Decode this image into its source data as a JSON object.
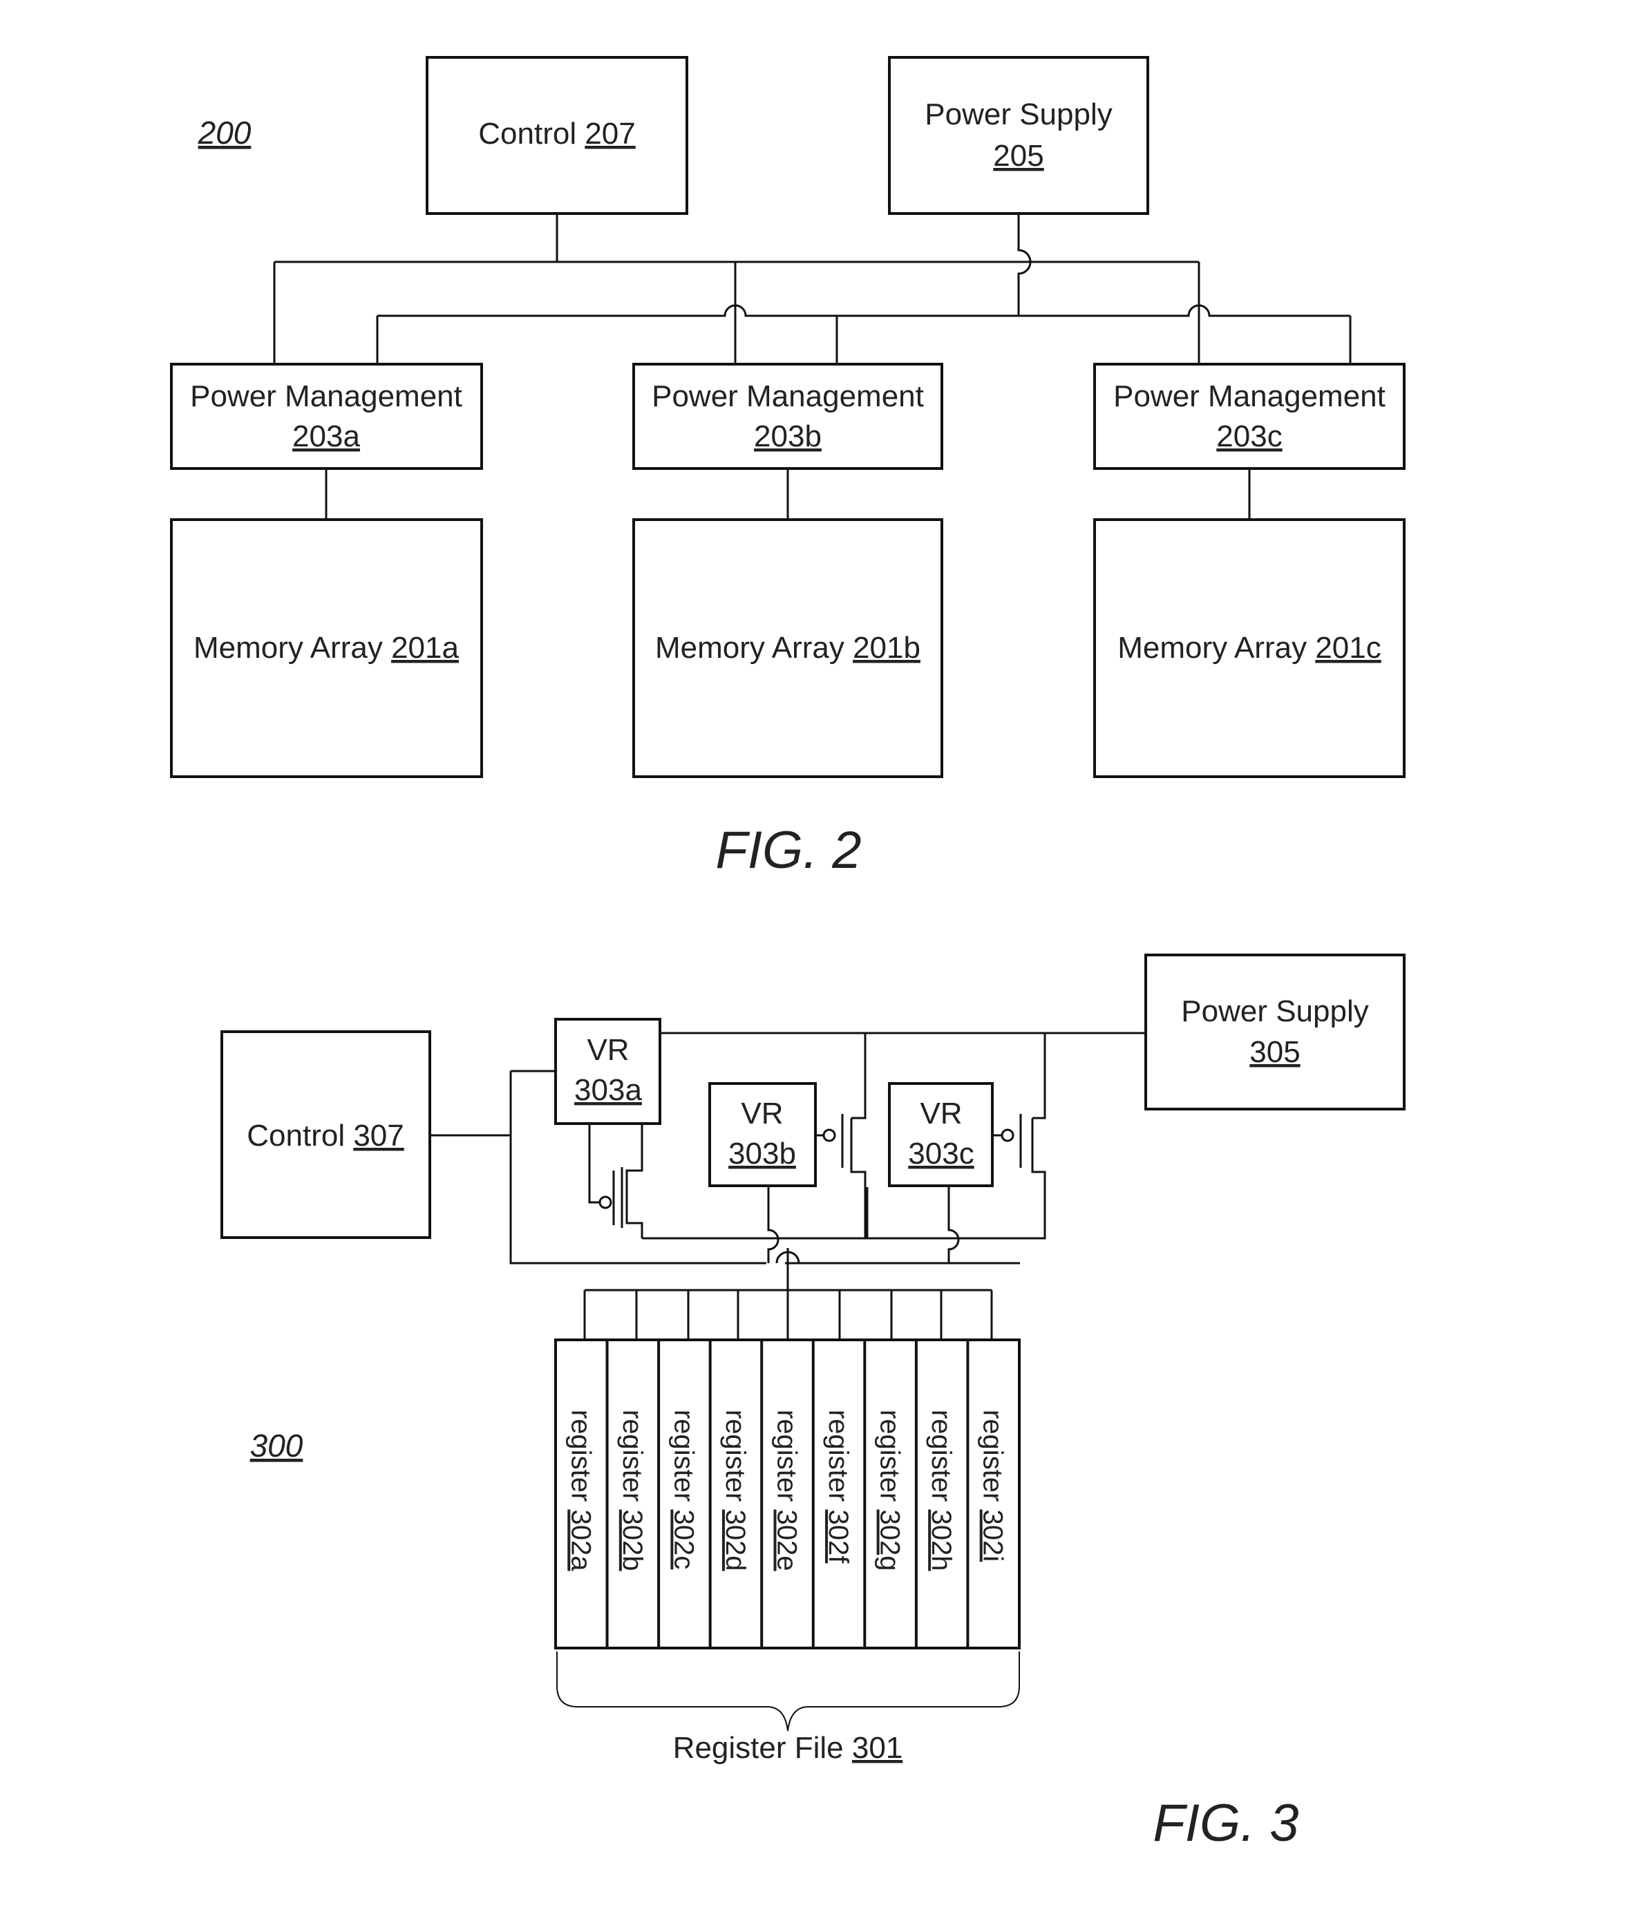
{
  "fig2": {
    "figure_number": "200",
    "caption": "FIG. 2",
    "control": {
      "label": "Control",
      "ref": "207"
    },
    "power_supply": {
      "label": "Power Supply",
      "ref": "205"
    },
    "power_management": [
      {
        "label": "Power Management",
        "ref": "203a"
      },
      {
        "label": "Power Management",
        "ref": "203b"
      },
      {
        "label": "Power Management",
        "ref": "203c"
      }
    ],
    "memory_arrays": [
      {
        "label": "Memory Array",
        "ref": "201a"
      },
      {
        "label": "Memory Array",
        "ref": "201b"
      },
      {
        "label": "Memory Array",
        "ref": "201c"
      }
    ]
  },
  "fig3": {
    "figure_number": "300",
    "caption": "FIG. 3",
    "control": {
      "label": "Control",
      "ref": "307"
    },
    "power_supply": {
      "label": "Power Supply",
      "ref": "305"
    },
    "voltage_regulators": [
      {
        "label": "VR",
        "ref": "303a"
      },
      {
        "label": "VR",
        "ref": "303b"
      },
      {
        "label": "VR",
        "ref": "303c"
      }
    ],
    "registers": [
      {
        "label": "register",
        "ref": "302a"
      },
      {
        "label": "register",
        "ref": "302b"
      },
      {
        "label": "register",
        "ref": "302c"
      },
      {
        "label": "register",
        "ref": "302d"
      },
      {
        "label": "register",
        "ref": "302e"
      },
      {
        "label": "register",
        "ref": "302f"
      },
      {
        "label": "register",
        "ref": "302g"
      },
      {
        "label": "register",
        "ref": "302h"
      },
      {
        "label": "register",
        "ref": "302i"
      }
    ],
    "register_file": {
      "label": "Register File",
      "ref": "301"
    }
  }
}
